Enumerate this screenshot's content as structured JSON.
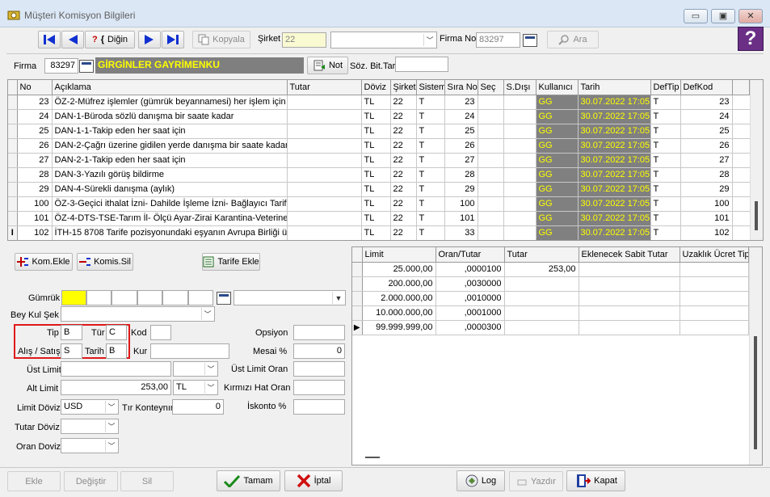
{
  "window": {
    "title": "Müşteri Komisyon Bilgileri",
    "min": "▭",
    "max": "▣",
    "close": "✕"
  },
  "toolbar": {
    "first_icon": "first-record-icon",
    "prev_icon": "prev-record-icon",
    "find_label": "Diğin",
    "next_icon": "next-record-icon",
    "last_icon": "last-record-icon",
    "copy_label": "Kopyala",
    "sirket_label": "Şirket",
    "sirket_value": "22",
    "combo_value": "",
    "firma_no_label": "Firma No",
    "firma_no_value": "83297",
    "search_label": "Ara",
    "help_label": "?"
  },
  "firma_row": {
    "label": "Firma",
    "code": "83297",
    "name": "GİRGİNLER GAYRİMENKU",
    "not_label": "Not",
    "soz_label": "Söz. Bit.Tar",
    "soz_value": ""
  },
  "grid": {
    "columns": [
      "No",
      "Açıklama",
      "Tutar",
      "Döviz",
      "Şirket",
      "Sistem",
      "Sıra No",
      "Seç",
      "S.Dışı",
      "Kullanıcı",
      "Tarih",
      "DefTip",
      "DefKod"
    ],
    "rows": [
      {
        "no": "23",
        "aciklama": "ÖZ-2-Müfrez işlemler (gümrük beyannamesi) her işlem için",
        "tutar": "",
        "doviz": "TL",
        "sirket": "22",
        "sistem": "T",
        "sira": "23",
        "sec": "",
        "sdisi": "",
        "kullanici": "GG",
        "tarih": "30.07.2022 17:05",
        "deftip": "T",
        "defkod": "23"
      },
      {
        "no": "24",
        "aciklama": "DAN-1-Büroda sözlü danışma bir saate kadar",
        "tutar": "",
        "doviz": "TL",
        "sirket": "22",
        "sistem": "T",
        "sira": "24",
        "sec": "",
        "sdisi": "",
        "kullanici": "GG",
        "tarih": "30.07.2022 17:05",
        "deftip": "T",
        "defkod": "24"
      },
      {
        "no": "25",
        "aciklama": "DAN-1-1-Takip eden her saat için",
        "tutar": "",
        "doviz": "TL",
        "sirket": "22",
        "sistem": "T",
        "sira": "25",
        "sec": "",
        "sdisi": "",
        "kullanici": "GG",
        "tarih": "30.07.2022 17:05",
        "deftip": "T",
        "defkod": "25"
      },
      {
        "no": "26",
        "aciklama": "DAN-2-Çağrı üzerine gidilen yerde danışma bir saate kadar",
        "tutar": "",
        "doviz": "TL",
        "sirket": "22",
        "sistem": "T",
        "sira": "26",
        "sec": "",
        "sdisi": "",
        "kullanici": "GG",
        "tarih": "30.07.2022 17:05",
        "deftip": "T",
        "defkod": "26"
      },
      {
        "no": "27",
        "aciklama": "DAN-2-1-Takip eden her saat için",
        "tutar": "",
        "doviz": "TL",
        "sirket": "22",
        "sistem": "T",
        "sira": "27",
        "sec": "",
        "sdisi": "",
        "kullanici": "GG",
        "tarih": "30.07.2022 17:05",
        "deftip": "T",
        "defkod": "27"
      },
      {
        "no": "28",
        "aciklama": "DAN-3-Yazılı görüş bildirme",
        "tutar": "",
        "doviz": "TL",
        "sirket": "22",
        "sistem": "T",
        "sira": "28",
        "sec": "",
        "sdisi": "",
        "kullanici": "GG",
        "tarih": "30.07.2022 17:05",
        "deftip": "T",
        "defkod": "28"
      },
      {
        "no": "29",
        "aciklama": "DAN-4-Sürekli danışma (aylık)",
        "tutar": "",
        "doviz": "TL",
        "sirket": "22",
        "sistem": "T",
        "sira": "29",
        "sec": "",
        "sdisi": "",
        "kullanici": "GG",
        "tarih": "30.07.2022 17:05",
        "deftip": "T",
        "defkod": "29"
      },
      {
        "no": "100",
        "aciklama": "ÖZ-3-Geçici ithalat İzni- Dahilde İşleme İzni- Bağlayıcı Tarife B",
        "tutar": "",
        "doviz": "TL",
        "sirket": "22",
        "sistem": "T",
        "sira": "100",
        "sec": "",
        "sdisi": "",
        "kullanici": "GG",
        "tarih": "30.07.2022 17:05",
        "deftip": "T",
        "defkod": "100"
      },
      {
        "no": "101",
        "aciklama": "ÖZ-4-DTS-TSE-Tarım İl- Ölçü Ayar-Zirai Karantina-Veterinerlik",
        "tutar": "",
        "doviz": "TL",
        "sirket": "22",
        "sistem": "T",
        "sira": "101",
        "sec": "",
        "sdisi": "",
        "kullanici": "GG",
        "tarih": "30.07.2022 17:05",
        "deftip": "T",
        "defkod": "101"
      },
      {
        "no": "102",
        "aciklama": "İTH-15 8708 Tarife pozisyonundaki eşyanın Avrupa Birliği ülk",
        "tutar": "",
        "doviz": "TL",
        "sirket": "22",
        "sistem": "T",
        "sira": "33",
        "sec": "",
        "sdisi": "",
        "kullanici": "GG",
        "tarih": "30.07.2022 17:05",
        "deftip": "T",
        "defkod": "102"
      }
    ]
  },
  "left_panel": {
    "kom_ekle": "Kom.Ekle",
    "komis_sil": "Komis.Sil",
    "tarife_ekle": "Tarife Ekle",
    "gumruk_label": "Gümrük",
    "gumruk_combo": "",
    "bey_kul_label": "Bey Kul Şek",
    "bey_kul_value": "",
    "tip_label": "Tip",
    "tip_value": "B",
    "tur_label": "Tür",
    "tur_value": "C",
    "alis_label": "Alış / Satış",
    "alis_value": "S",
    "tarih_label": "Tarih",
    "tarih_value": "B",
    "kod_label": "Kod",
    "kod_value": "",
    "kur_label": "Kur",
    "kur_value": "",
    "opsiyon_label": "Opsiyon",
    "opsiyon_value": "",
    "mesai_label": "Mesai %",
    "mesai_value": "0",
    "ust_limit_label": "Üst Limit",
    "ust_limit_value": "",
    "ust_limit_oran_label": "Üst Limit Oran",
    "ust_limit_oran_value": "",
    "alt_limit_label": "Alt Limit",
    "alt_limit_value": "253,00",
    "alt_limit_cur": "TL",
    "kirmizi_label": "Kırmızı Hat Oran",
    "kirmizi_value": "",
    "limit_doviz_label": "Limit Döviz",
    "limit_doviz_value": "USD",
    "tir_label": "Tır Konteynır",
    "tir_value": "0",
    "iskonto_label": "İskonto %",
    "iskonto_value": "",
    "tutar_doviz_label": "Tutar Döviz",
    "tutar_doviz_value": "",
    "oran_doviz_label": "Oran Doviz",
    "oran_doviz_value": ""
  },
  "limit_grid": {
    "columns": [
      "Limit",
      "Oran/Tutar",
      "Tutar",
      "Eklenecek Sabit Tutar",
      "Uzaklık Ücret Tip"
    ],
    "rows": [
      {
        "limit": "25.000,00",
        "oran": ",0000100",
        "tutar": "253,00",
        "sabit": "",
        "uzaklik": ""
      },
      {
        "limit": "200.000,00",
        "oran": ",0030000",
        "tutar": "",
        "sabit": "",
        "uzaklik": ""
      },
      {
        "limit": "2.000.000,00",
        "oran": ",0010000",
        "tutar": "",
        "sabit": "",
        "uzaklik": ""
      },
      {
        "limit": "10.000.000,00",
        "oran": ",0001000",
        "tutar": "",
        "sabit": "",
        "uzaklik": ""
      },
      {
        "limit": "99.999.999,00",
        "oran": ",0000300",
        "tutar": "",
        "sabit": "",
        "uzaklik": ""
      }
    ]
  },
  "bottom": {
    "ekle": "Ekle",
    "degistir": "Değiştir",
    "sil": "Sil",
    "tamam": "Tamam",
    "iptal": "İptal",
    "log": "Log",
    "yazdir": "Yazdır",
    "kapat": "Kapat"
  },
  "colors": {
    "firma_name_bg": "#7f7f7f",
    "firma_name_fg": "#ffff00",
    "user_cell_bg": "#808080",
    "user_cell_fg": "#ffff00",
    "gumruk_yellow": "#ffff00",
    "highlight_box": "#e01818"
  }
}
